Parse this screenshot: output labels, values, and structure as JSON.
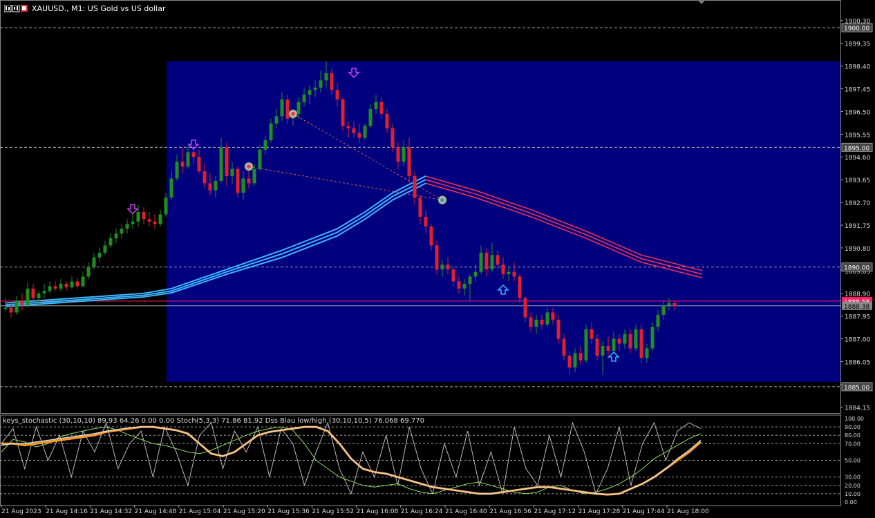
{
  "window": {
    "symbol_title": "XAUUSD., M1:  US Gold vs US dollar"
  },
  "colors": {
    "background": "#000000",
    "rect_fill": "#00007f",
    "bull": "#1f8f1f",
    "bear": "#e0202a",
    "ma_blue": "#3ab8ff",
    "ma_red": "#ff3050",
    "price_line": "#ff2060",
    "bid_line": "#9aa",
    "sto_orange": "#ff9a20",
    "sto_white": "#d8d8d8",
    "sto_green": "#8fe060",
    "arrow_down": "#d040ff",
    "arrow_up": "#3ab8ff"
  },
  "price_axis": {
    "labels": [
      "1900.30",
      "1899.35",
      "1898.40",
      "1897.45",
      "1896.50",
      "1895.55",
      "1894.60",
      "1893.65",
      "1892.70",
      "1891.75",
      "1890.80",
      "1889.85",
      "1888.90",
      "1887.95",
      "1887.00",
      "1886.05",
      "1885.10",
      "1884.15"
    ],
    "levels": [
      {
        "label": "1900.00",
        "value": 1900.0
      },
      {
        "label": "1895.00",
        "value": 1895.0
      },
      {
        "label": "1890.00",
        "value": 1890.0
      },
      {
        "label": "1885.00",
        "value": 1885.0
      }
    ],
    "current_label": "1888.38",
    "current_value": 1888.38,
    "ask_label": "1888.58",
    "ask_value": 1888.58
  },
  "time_axis": {
    "labels": [
      "21 Aug 2023",
      "21 Aug 14:16",
      "21 Aug 14:32",
      "21 Aug 14:48",
      "21 Aug 15:04",
      "21 Aug 15:20",
      "21 Aug 15:36",
      "21 Aug 15:52",
      "21 Aug 16:08",
      "21 Aug 16:24",
      "21 Aug 16:40",
      "21 Aug 16:56",
      "21 Aug 17:12",
      "21 Aug 17:28",
      "21 Aug 17:44",
      "21 Aug 18:00"
    ]
  },
  "indicator": {
    "label": "keys_stochastic (30,10,10) 89.93 64.26 0.00 0.00  Stoch(5,3,3) 71.86 81.92  Dss Blau low/high (30,10,10,5) 76.068 69.770",
    "axis_labels": [
      "100.00",
      "90.00",
      "80.00",
      "70.00",
      "50.00",
      "30.00",
      "20.00",
      "10.00",
      "0.00"
    ]
  },
  "chart_data": {
    "type": "candlestick",
    "title": "XAUUSD., M1:  US Gold vs US dollar",
    "ylim": [
      1883.9,
      1901.1
    ],
    "highlight_box": {
      "y_top": 1898.6,
      "y_bottom": 1885.2
    },
    "candles": [
      [
        1888.25,
        1888.7,
        1888.15,
        1888.3
      ],
      [
        1888.3,
        1888.5,
        1887.9,
        1888.1
      ],
      [
        1888.1,
        1888.8,
        1888.0,
        1888.6
      ],
      [
        1888.6,
        1888.9,
        1888.2,
        1888.4
      ],
      [
        1888.4,
        1889.35,
        1888.3,
        1889.1
      ],
      [
        1889.1,
        1889.3,
        1888.6,
        1888.7
      ],
      [
        1888.7,
        1889.0,
        1888.4,
        1888.9
      ],
      [
        1888.9,
        1889.3,
        1888.7,
        1889.0
      ],
      [
        1889.0,
        1889.4,
        1888.9,
        1889.2
      ],
      [
        1889.2,
        1889.4,
        1889.0,
        1889.1
      ],
      [
        1889.1,
        1889.5,
        1889.0,
        1889.3
      ],
      [
        1889.3,
        1889.4,
        1889.0,
        1889.15
      ],
      [
        1889.15,
        1889.6,
        1889.1,
        1889.4
      ],
      [
        1889.4,
        1889.55,
        1889.1,
        1889.2
      ],
      [
        1889.2,
        1889.8,
        1889.15,
        1889.6
      ],
      [
        1889.6,
        1890.2,
        1889.5,
        1890.0
      ],
      [
        1890.0,
        1890.6,
        1889.9,
        1890.4
      ],
      [
        1890.4,
        1890.8,
        1890.2,
        1890.6
      ],
      [
        1890.6,
        1891.1,
        1890.5,
        1890.9
      ],
      [
        1890.9,
        1891.4,
        1890.8,
        1891.2
      ],
      [
        1891.2,
        1891.6,
        1891.0,
        1891.4
      ],
      [
        1891.4,
        1891.8,
        1891.2,
        1891.6
      ],
      [
        1891.6,
        1892.0,
        1891.4,
        1891.8
      ],
      [
        1891.8,
        1892.2,
        1891.6,
        1891.9
      ],
      [
        1891.9,
        1892.6,
        1891.7,
        1892.3
      ],
      [
        1892.3,
        1892.5,
        1891.8,
        1892.0
      ],
      [
        1892.0,
        1892.3,
        1891.7,
        1891.9
      ],
      [
        1891.9,
        1892.2,
        1891.6,
        1891.8
      ],
      [
        1891.8,
        1892.4,
        1891.7,
        1892.2
      ],
      [
        1892.2,
        1893.1,
        1892.1,
        1892.9
      ],
      [
        1892.9,
        1894.0,
        1892.8,
        1893.7
      ],
      [
        1893.7,
        1894.7,
        1893.6,
        1894.4
      ],
      [
        1894.4,
        1895.0,
        1893.9,
        1894.2
      ],
      [
        1894.2,
        1895.1,
        1894.1,
        1894.8
      ],
      [
        1894.8,
        1895.1,
        1894.3,
        1894.6
      ],
      [
        1894.6,
        1894.9,
        1893.9,
        1894.0
      ],
      [
        1894.0,
        1894.3,
        1893.3,
        1893.5
      ],
      [
        1893.5,
        1893.9,
        1893.0,
        1893.2
      ],
      [
        1893.2,
        1893.8,
        1892.9,
        1893.6
      ],
      [
        1893.6,
        1895.4,
        1893.5,
        1895.0
      ],
      [
        1895.0,
        1895.2,
        1893.4,
        1893.8
      ],
      [
        1893.8,
        1894.4,
        1893.5,
        1894.1
      ],
      [
        1894.1,
        1894.2,
        1892.9,
        1893.1
      ],
      [
        1893.1,
        1894.0,
        1892.8,
        1893.7
      ],
      [
        1893.7,
        1894.1,
        1893.3,
        1893.5
      ],
      [
        1893.5,
        1894.3,
        1893.4,
        1894.1
      ],
      [
        1894.1,
        1895.1,
        1894.0,
        1894.9
      ],
      [
        1894.9,
        1895.5,
        1894.7,
        1895.3
      ],
      [
        1895.3,
        1896.2,
        1895.2,
        1896.0
      ],
      [
        1896.0,
        1896.6,
        1895.8,
        1896.3
      ],
      [
        1896.3,
        1897.3,
        1896.1,
        1897.0
      ],
      [
        1897.0,
        1897.2,
        1896.0,
        1896.2
      ],
      [
        1896.2,
        1896.6,
        1895.9,
        1896.4
      ],
      [
        1896.4,
        1897.1,
        1896.2,
        1896.9
      ],
      [
        1896.9,
        1897.5,
        1896.7,
        1897.2
      ],
      [
        1897.2,
        1897.6,
        1896.8,
        1897.4
      ],
      [
        1897.4,
        1897.8,
        1897.1,
        1897.5
      ],
      [
        1897.5,
        1898.2,
        1897.3,
        1897.8
      ],
      [
        1897.8,
        1898.6,
        1897.5,
        1898.1
      ],
      [
        1898.1,
        1898.3,
        1897.2,
        1897.4
      ],
      [
        1897.4,
        1897.7,
        1896.7,
        1897.0
      ],
      [
        1897.0,
        1897.1,
        1895.7,
        1895.9
      ],
      [
        1895.9,
        1896.1,
        1895.4,
        1895.8
      ],
      [
        1895.8,
        1896.1,
        1895.4,
        1895.6
      ],
      [
        1895.6,
        1896.0,
        1895.2,
        1895.4
      ],
      [
        1895.4,
        1896.0,
        1895.3,
        1895.9
      ],
      [
        1895.9,
        1896.8,
        1895.8,
        1896.6
      ],
      [
        1896.6,
        1897.2,
        1896.4,
        1896.9
      ],
      [
        1896.9,
        1897.1,
        1896.2,
        1896.4
      ],
      [
        1896.4,
        1896.6,
        1895.6,
        1895.8
      ],
      [
        1895.8,
        1896.0,
        1894.8,
        1895.0
      ],
      [
        1895.0,
        1895.2,
        1894.1,
        1894.4
      ],
      [
        1894.4,
        1895.3,
        1894.2,
        1895.0
      ],
      [
        1895.0,
        1895.4,
        1893.5,
        1893.8
      ],
      [
        1893.8,
        1894.0,
        1892.6,
        1892.9
      ],
      [
        1892.9,
        1893.0,
        1891.8,
        1892.1
      ],
      [
        1892.1,
        1892.4,
        1891.4,
        1891.7
      ],
      [
        1891.7,
        1891.8,
        1890.7,
        1890.9
      ],
      [
        1890.9,
        1891.1,
        1889.7,
        1889.9
      ],
      [
        1889.9,
        1890.3,
        1889.6,
        1890.1
      ],
      [
        1890.1,
        1890.4,
        1889.7,
        1889.9
      ],
      [
        1889.9,
        1890.0,
        1889.2,
        1889.4
      ],
      [
        1889.4,
        1889.6,
        1888.9,
        1889.1
      ],
      [
        1889.1,
        1889.5,
        1888.8,
        1889.3
      ],
      [
        1889.3,
        1889.7,
        1888.6,
        1889.6
      ],
      [
        1889.6,
        1890.1,
        1889.4,
        1889.8
      ],
      [
        1889.8,
        1890.9,
        1889.7,
        1890.6
      ],
      [
        1890.6,
        1890.8,
        1889.6,
        1889.9
      ],
      [
        1889.9,
        1891.0,
        1889.8,
        1890.5
      ],
      [
        1890.5,
        1890.7,
        1889.9,
        1890.1
      ],
      [
        1890.1,
        1890.4,
        1889.5,
        1889.7
      ],
      [
        1889.7,
        1890.0,
        1889.4,
        1889.8
      ],
      [
        1889.8,
        1890.2,
        1889.4,
        1889.6
      ],
      [
        1889.6,
        1889.7,
        1888.5,
        1888.7
      ],
      [
        1888.7,
        1888.8,
        1887.7,
        1887.9
      ],
      [
        1887.9,
        1888.1,
        1887.3,
        1887.5
      ],
      [
        1887.5,
        1888.0,
        1887.2,
        1887.8
      ],
      [
        1887.8,
        1888.0,
        1887.4,
        1887.6
      ],
      [
        1887.6,
        1888.3,
        1887.5,
        1888.1
      ],
      [
        1888.1,
        1888.3,
        1887.6,
        1887.8
      ],
      [
        1887.8,
        1888.0,
        1886.8,
        1887.0
      ],
      [
        1887.0,
        1887.2,
        1886.1,
        1886.3
      ],
      [
        1886.3,
        1886.5,
        1885.5,
        1885.8
      ],
      [
        1885.8,
        1886.6,
        1885.6,
        1886.4
      ],
      [
        1886.4,
        1886.7,
        1885.9,
        1886.1
      ],
      [
        1886.1,
        1887.6,
        1886.0,
        1887.4
      ],
      [
        1887.4,
        1887.7,
        1886.8,
        1887.0
      ],
      [
        1887.0,
        1887.2,
        1886.1,
        1886.3
      ],
      [
        1886.3,
        1886.9,
        1885.5,
        1886.7
      ],
      [
        1886.7,
        1887.1,
        1886.2,
        1886.5
      ],
      [
        1886.5,
        1887.3,
        1886.4,
        1887.0
      ],
      [
        1887.0,
        1887.2,
        1886.5,
        1886.8
      ],
      [
        1886.8,
        1887.4,
        1886.6,
        1887.2
      ],
      [
        1887.2,
        1887.4,
        1886.4,
        1886.6
      ],
      [
        1886.6,
        1887.6,
        1886.5,
        1887.4
      ],
      [
        1887.4,
        1887.6,
        1886.0,
        1886.2
      ],
      [
        1886.2,
        1886.8,
        1886.0,
        1886.6
      ],
      [
        1886.6,
        1887.7,
        1886.5,
        1887.5
      ],
      [
        1887.5,
        1888.2,
        1887.3,
        1888.0
      ],
      [
        1888.0,
        1888.6,
        1887.8,
        1888.4
      ],
      [
        1888.4,
        1888.7,
        1888.2,
        1888.5
      ],
      [
        1888.5,
        1888.6,
        1888.2,
        1888.38
      ]
    ],
    "ma_blue_bands": [
      {
        "name": "",
        "points": [
          [
            0,
            1888.5
          ],
          [
            25,
            1888.9
          ],
          [
            30,
            1889.1
          ],
          [
            40,
            1889.9
          ],
          [
            50,
            1890.7
          ],
          [
            60,
            1891.6
          ],
          [
            65,
            1892.3
          ],
          [
            70,
            1893.1
          ],
          [
            76,
            1893.8
          ]
        ]
      },
      {
        "name": "",
        "points": [
          [
            0,
            1888.42
          ],
          [
            25,
            1888.82
          ],
          [
            30,
            1889.0
          ],
          [
            40,
            1889.8
          ],
          [
            50,
            1890.55
          ],
          [
            60,
            1891.45
          ],
          [
            65,
            1892.15
          ],
          [
            70,
            1892.95
          ],
          [
            76,
            1893.65
          ]
        ]
      },
      {
        "name": "",
        "points": [
          [
            0,
            1888.35
          ],
          [
            25,
            1888.75
          ],
          [
            30,
            1888.92
          ],
          [
            40,
            1889.7
          ],
          [
            50,
            1890.4
          ],
          [
            60,
            1891.3
          ],
          [
            65,
            1892.0
          ],
          [
            70,
            1892.8
          ],
          [
            76,
            1893.5
          ]
        ]
      }
    ],
    "ma_red_bands": [
      {
        "name": "",
        "points": [
          [
            76,
            1893.8
          ],
          [
            85,
            1893.2
          ],
          [
            95,
            1892.4
          ],
          [
            105,
            1891.5
          ],
          [
            115,
            1890.5
          ],
          [
            126,
            1889.85
          ]
        ]
      },
      {
        "name": "",
        "points": [
          [
            76,
            1893.65
          ],
          [
            85,
            1893.05
          ],
          [
            95,
            1892.25
          ],
          [
            105,
            1891.35
          ],
          [
            115,
            1890.35
          ],
          [
            126,
            1889.7
          ]
        ]
      },
      {
        "name": "",
        "points": [
          [
            76,
            1893.5
          ],
          [
            85,
            1892.9
          ],
          [
            95,
            1892.1
          ],
          [
            105,
            1891.2
          ],
          [
            115,
            1890.2
          ],
          [
            126,
            1889.55
          ]
        ]
      }
    ],
    "arrows_down": [
      [
        23,
        1892.2
      ],
      [
        34,
        1894.9
      ],
      [
        63,
        1897.9
      ]
    ],
    "arrows_up": [
      [
        90,
        1889.3
      ],
      [
        110,
        1886.5
      ]
    ],
    "signal_markers": [
      [
        44,
        1894.2
      ],
      [
        52,
        1896.4
      ],
      [
        79,
        1892.8
      ]
    ],
    "stochastic": {
      "ylim": [
        0,
        100
      ],
      "main_orange": [
        70,
        70,
        68,
        70,
        72,
        74,
        76,
        78,
        80,
        84,
        86,
        88,
        90,
        90,
        88,
        86,
        82,
        70,
        58,
        55,
        60,
        70,
        80,
        84,
        86,
        88,
        90,
        90,
        85,
        70,
        52,
        40,
        36,
        34,
        30,
        26,
        22,
        18,
        16,
        14,
        12,
        10,
        10,
        12,
        14,
        16,
        18,
        18,
        16,
        14,
        12,
        10,
        9,
        10,
        16,
        22,
        30,
        40,
        50,
        60,
        72
      ],
      "main_white": [
        68,
        70,
        70,
        72,
        74,
        76,
        78,
        80,
        82,
        85,
        87,
        89,
        90,
        90,
        88,
        86,
        82,
        70,
        58,
        55,
        60,
        70,
        80,
        84,
        86,
        88,
        90,
        90,
        85,
        70,
        52,
        40,
        36,
        34,
        30,
        26,
        22,
        18,
        16,
        14,
        12,
        10,
        10,
        12,
        14,
        16,
        18,
        18,
        16,
        14,
        12,
        10,
        9,
        10,
        16,
        22,
        30,
        40,
        52,
        62,
        74
      ],
      "green": [
        60,
        75,
        72,
        66,
        70,
        78,
        82,
        85,
        88,
        90,
        86,
        80,
        75,
        70,
        68,
        64,
        60,
        58,
        62,
        68,
        74,
        80,
        85,
        88,
        90,
        86,
        70,
        50,
        40,
        30,
        25,
        20,
        18,
        20,
        22,
        16,
        12,
        10,
        14,
        18,
        22,
        24,
        20,
        16,
        12,
        10,
        12,
        18,
        20,
        14,
        10,
        12,
        16,
        22,
        30,
        40,
        52,
        60,
        68,
        76,
        82
      ],
      "fast_gray": [
        70,
        88,
        40,
        90,
        50,
        80,
        30,
        85,
        60,
        95,
        40,
        70,
        85,
        30,
        90,
        60,
        20,
        80,
        95,
        40,
        85,
        60,
        90,
        30,
        88,
        70,
        20,
        60,
        95,
        40,
        10,
        60,
        30,
        80,
        20,
        90,
        40,
        10,
        70,
        30,
        85,
        20,
        60,
        10,
        90,
        40,
        20,
        80,
        30,
        95,
        60,
        10,
        40,
        90,
        20,
        70,
        95,
        50,
        85,
        95,
        88
      ]
    }
  }
}
